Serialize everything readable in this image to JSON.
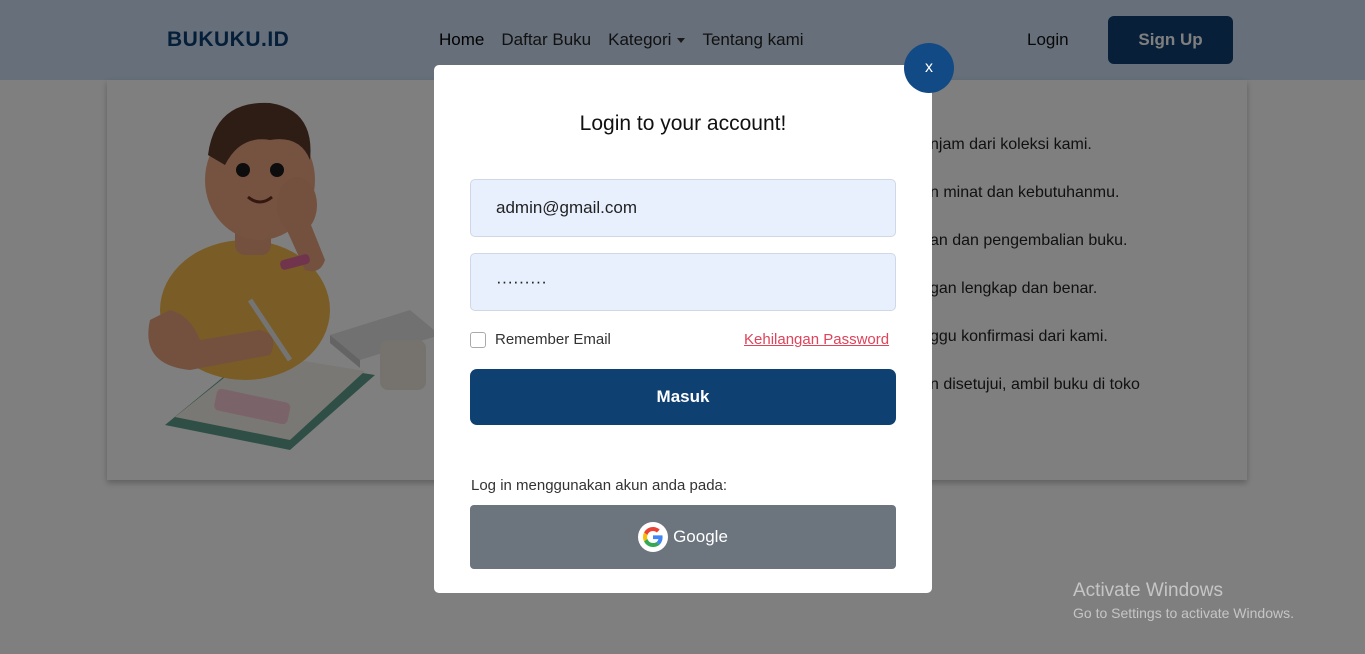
{
  "navbar": {
    "brand": "BUKUKU.ID",
    "links": [
      {
        "label": "Home"
      },
      {
        "label": "Daftar Buku"
      },
      {
        "label": "Kategori"
      },
      {
        "label": "Tentang kami"
      }
    ],
    "login_label": "Login",
    "signup_label": "Sign Up"
  },
  "background": {
    "steps": [
      "njam dari koleksi kami.",
      "n minat dan kebutuhanmu.",
      "an dan pengembalian buku.",
      "gan lengkap dan benar.",
      "ggu konfirmasi dari kami.",
      "n disetujui, ambil buku di toko"
    ]
  },
  "modal": {
    "close_label": "x",
    "title": "Login to your account!",
    "email_value": "admin@gmail.com",
    "password_value": "·········",
    "remember_label": "Remember Email",
    "forgot_label": "Kehilangan Password",
    "submit_label": "Masuk",
    "alt_login_label": "Log in menggunakan akun anda pada:",
    "google_label": "Google"
  },
  "watermark": {
    "title": "Activate Windows",
    "subtitle": "Go to Settings to activate Windows."
  },
  "colors": {
    "primary": "#0e4072",
    "close": "#124a85",
    "link": "#e0435a",
    "google_btn": "#6c757d"
  }
}
